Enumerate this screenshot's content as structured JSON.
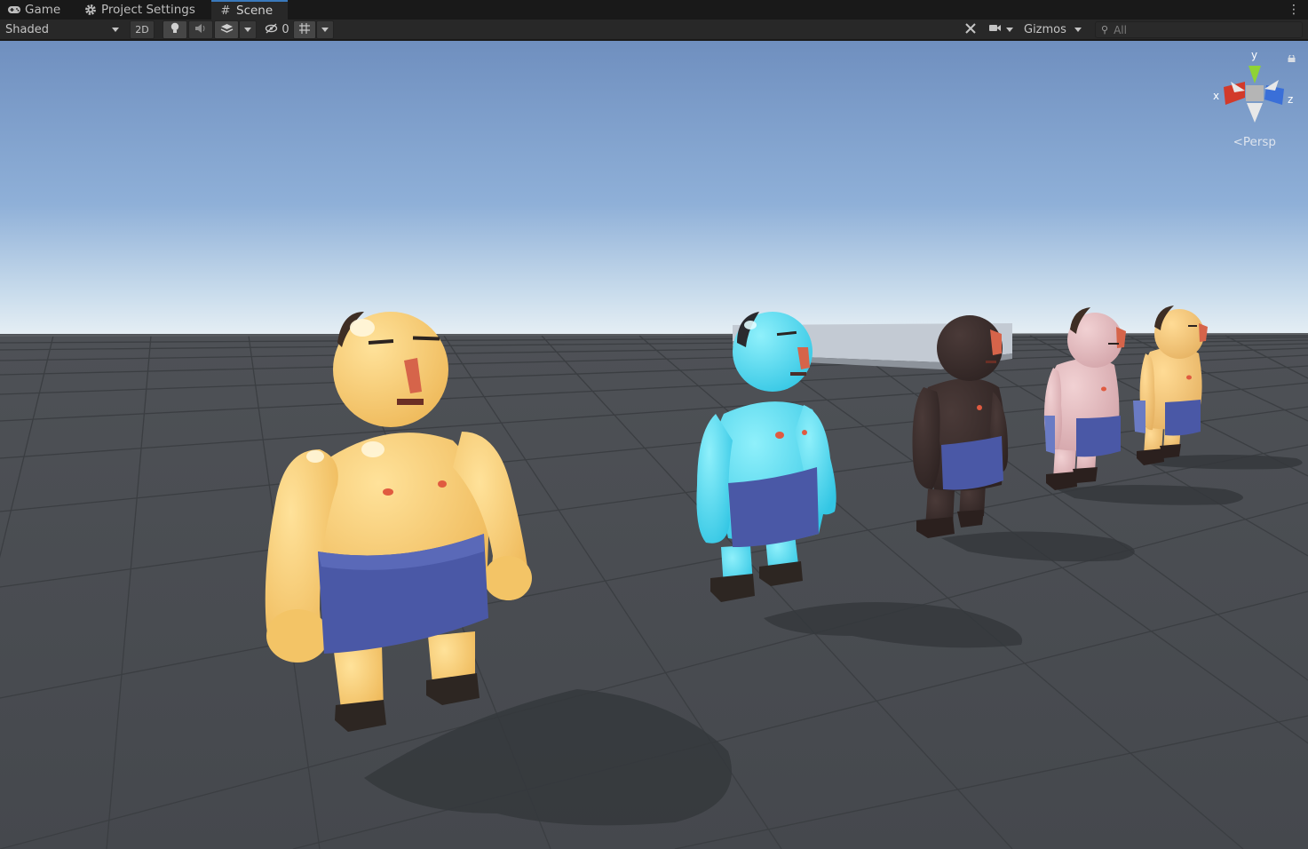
{
  "tabs": [
    {
      "label": "Game",
      "icon": "gamepad-icon",
      "active": false
    },
    {
      "label": "Project Settings",
      "icon": "gear-icon",
      "active": false
    },
    {
      "label": "Scene",
      "icon": "grid-hash-icon",
      "active": true
    }
  ],
  "toolbar": {
    "draw_mode": "Shaded",
    "toggle_2d": "2D",
    "hidden_count": "0",
    "gizmos_label": "Gizmos",
    "search_placeholder": "All"
  },
  "scene_gizmo": {
    "x_label": "x",
    "y_label": "y",
    "z_label": "z",
    "projection_label": "Persp"
  },
  "colors": {
    "accent_tab": "#3a79bb",
    "sky_top": "#6f8fbf",
    "sky_horizon": "#e6eef5",
    "ground": "#4a4d52",
    "axis_x": "#d23a2a",
    "axis_y": "#8fd335",
    "axis_z": "#3a6fd8"
  },
  "scene_objects": [
    {
      "name": "sumo-yellow-large",
      "skin": "#f6ca6c"
    },
    {
      "name": "sumo-cyan",
      "skin": "#4fd8ee"
    },
    {
      "name": "sumo-dark",
      "skin": "#3a2c2a"
    },
    {
      "name": "sumo-pink",
      "skin": "#e2b7bb"
    },
    {
      "name": "sumo-tan",
      "skin": "#f2c77a"
    }
  ]
}
